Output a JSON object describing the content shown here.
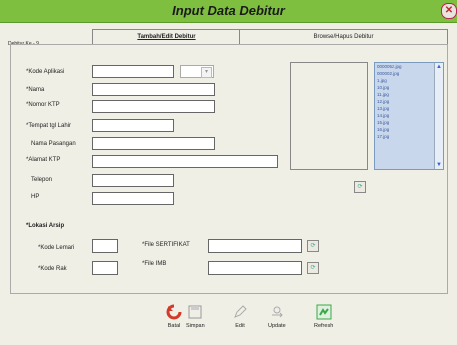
{
  "window": {
    "title": "Input Data Debitur",
    "close_icon": "close-icon"
  },
  "debitur_label": "Debitur Ke -   9",
  "tabs": [
    {
      "label": "Tambah/Edit Debitur"
    },
    {
      "label": "Browse/Hapus Debitur"
    }
  ],
  "form": {
    "kode_aplikasi": {
      "label": "*Kode Aplikasi",
      "value": ""
    },
    "nama": {
      "label": "*Nama",
      "value": ""
    },
    "nomor_ktp": {
      "label": "*Nomor KTP",
      "value": ""
    },
    "tempat_tgl_lahir": {
      "label": "*Tempat tgl Lahir",
      "value": ""
    },
    "nama_pasangan": {
      "label": "Nama Pasangan",
      "value": ""
    },
    "alamat_ktp": {
      "label": "*Alamat KTP",
      "value": ""
    },
    "telepon": {
      "label": "Telepon",
      "value": ""
    },
    "hp": {
      "label": "HP",
      "value": ""
    }
  },
  "files": {
    "list": [
      "000005z.jpg",
      "000002.jpg",
      "1.jpg",
      "10.jpg",
      "11.jpg",
      "12.jpg",
      "13.jpg",
      "14.jpg",
      "15.jpg",
      "16.jpg",
      "17.jpg"
    ]
  },
  "lokasi": {
    "heading": "*Lokasi Arsip",
    "kode_lemari": {
      "label": "*Kode Lemari",
      "value": ""
    },
    "kode_rak": {
      "label": "*Kode Rak",
      "value": ""
    },
    "file_sertifikat": {
      "label": "*File SERTIFIKAT",
      "value": ""
    },
    "file_imb": {
      "label": "*File IMB",
      "value": ""
    }
  },
  "toolbar": {
    "batal": "Batal",
    "simpan": "Simpan",
    "edit": "Edit",
    "update": "Update",
    "refresh": "Refresh"
  },
  "colors": {
    "titlebar": "#7fbf3f",
    "file_list_bg": "#c8d7ec",
    "batal_icon": "#d23b2a",
    "refresh_icon": "#3aa84a"
  }
}
